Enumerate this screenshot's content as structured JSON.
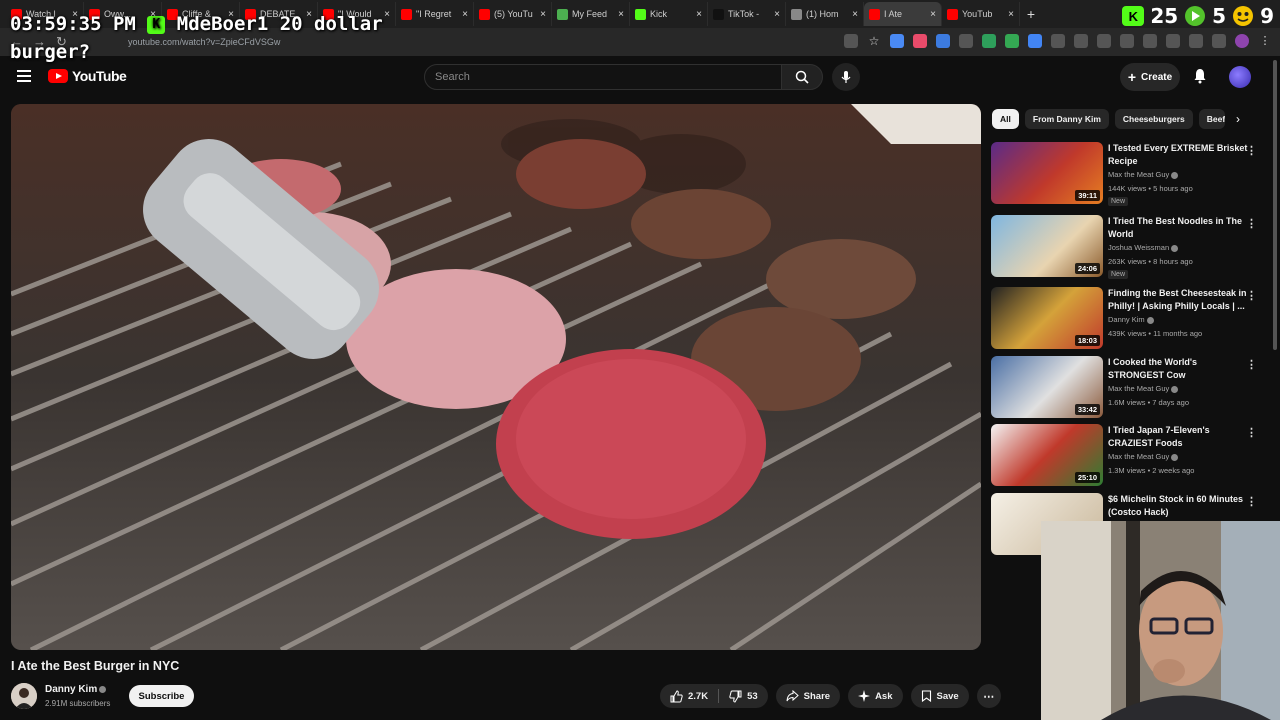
{
  "overlay": {
    "time": "03:59:35 PM",
    "user": "MdeBoer1",
    "message": "20 dollar burger?"
  },
  "browser": {
    "tabs": [
      {
        "label": "Watch l",
        "color": "#ff0000"
      },
      {
        "label": "Oww...",
        "color": "#ff0000"
      },
      {
        "label": "Cliffe &",
        "color": "#ff0000"
      },
      {
        "label": "DEBATE",
        "color": "#ff0000"
      },
      {
        "label": "\"I Would",
        "color": "#ff0000"
      },
      {
        "label": "\"I Regret",
        "color": "#ff0000"
      },
      {
        "label": "(5) YouTu",
        "color": "#ff0000"
      },
      {
        "label": "My Feed",
        "color": "#4caf50"
      },
      {
        "label": "Kick",
        "color": "#53fc18"
      },
      {
        "label": "TikTok -",
        "color": "#111111"
      },
      {
        "label": "(1) Hom",
        "color": "#888888"
      },
      {
        "label": "I Ate",
        "color": "#ff0000"
      },
      {
        "label": "YouTub",
        "color": "#ff0000"
      }
    ],
    "url": "youtube.com/watch?v=ZpieCFdVSGw",
    "ext_numbers": [
      "25",
      "5",
      "9"
    ]
  },
  "header": {
    "logo": "YouTube",
    "search_placeholder": "Search",
    "create_label": "Create"
  },
  "video": {
    "title": "I Ate the Best Burger in NYC",
    "channel": "Danny Kim",
    "subscribers": "2.91M subscribers",
    "subscribe_label": "Subscribe",
    "likes": "2.7K",
    "dislikes": "53",
    "share_label": "Share",
    "ask_label": "Ask",
    "save_label": "Save"
  },
  "chips": [
    "All",
    "From Danny Kim",
    "Cheeseburgers",
    "Beef"
  ],
  "recommendations": [
    {
      "title": "I Tested Every EXTREME Brisket Recipe",
      "channel": "Max the Meat Guy",
      "meta": "144K views • 5 hours ago",
      "duration": "39:11",
      "new": "New",
      "thumb": "linear-gradient(135deg,#5a2b88,#c0392b 55%,#e67e22)"
    },
    {
      "title": "I Tried The Best Noodles in The World",
      "channel": "Joshua Weissman",
      "meta": "263K views • 8 hours ago",
      "duration": "24:06",
      "new": "New",
      "thumb": "linear-gradient(135deg,#7fb6e0,#e8d4b0 60%,#8a5a2b)"
    },
    {
      "title": "Finding the Best Cheesesteak in Philly! | Asking Philly Locals | ...",
      "channel": "Danny Kim",
      "meta": "439K views • 11 months ago",
      "duration": "18:03",
      "new": "",
      "thumb": "linear-gradient(135deg,#222,#d4a23a 50%,#c0392b)"
    },
    {
      "title": "I Cooked the World's STRONGEST Cow",
      "channel": "Max the Meat Guy",
      "meta": "1.6M views • 7 days ago",
      "duration": "33:42",
      "new": "",
      "thumb": "linear-gradient(135deg,#4a6fa5,#e0e0e0 55%,#8b5a3c)"
    },
    {
      "title": "I Tried Japan 7-Eleven's CRAZIEST Foods",
      "channel": "Max the Meat Guy",
      "meta": "1.3M views • 2 weeks ago",
      "duration": "25:10",
      "new": "",
      "thumb": "linear-gradient(135deg,#f4f4f4,#c0392b 50%,#2e7d32)"
    },
    {
      "title": "$6 Michelin Stock in 60 Minutes (Costco Hack)",
      "channel": "",
      "meta": "",
      "duration": "",
      "new": "",
      "thumb": "linear-gradient(135deg,#f5f0e6,#c9b79a)"
    }
  ]
}
